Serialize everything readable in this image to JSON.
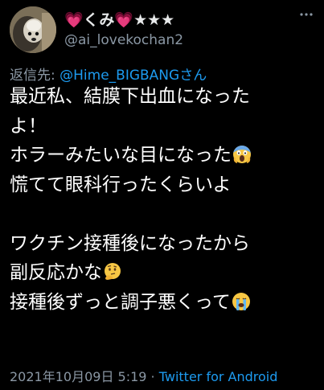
{
  "user": {
    "display_name": "💗くみ💗★★★",
    "handle": "@ai_lovekochan2"
  },
  "reply": {
    "prefix": "返信先: ",
    "mention": "@Hime_BIGBANGさん"
  },
  "body": {
    "line1": "最近私、結膜下出血になった",
    "line2": "よ！",
    "line3": "ホラーみたいな目になった",
    "line4": "慌てて眼科行ったくらいよ",
    "line5": "ワクチン接種後になったから",
    "line6": "副反応かな",
    "line7": "接種後ずっと調子悪くって"
  },
  "meta": {
    "datetime": "2021年10月09日 5:19",
    "separator": " · ",
    "source": "Twitter for Android"
  },
  "icons": {
    "emoji_line3": "screaming-face-icon",
    "emoji_line6": "thinking-face-icon",
    "emoji_line7": "crying-face-icon",
    "more": "more-dots-icon"
  },
  "colors": {
    "background": "#000000",
    "text": "#ffffff",
    "secondary": "#8b98a5",
    "link": "#1d9bf0"
  }
}
